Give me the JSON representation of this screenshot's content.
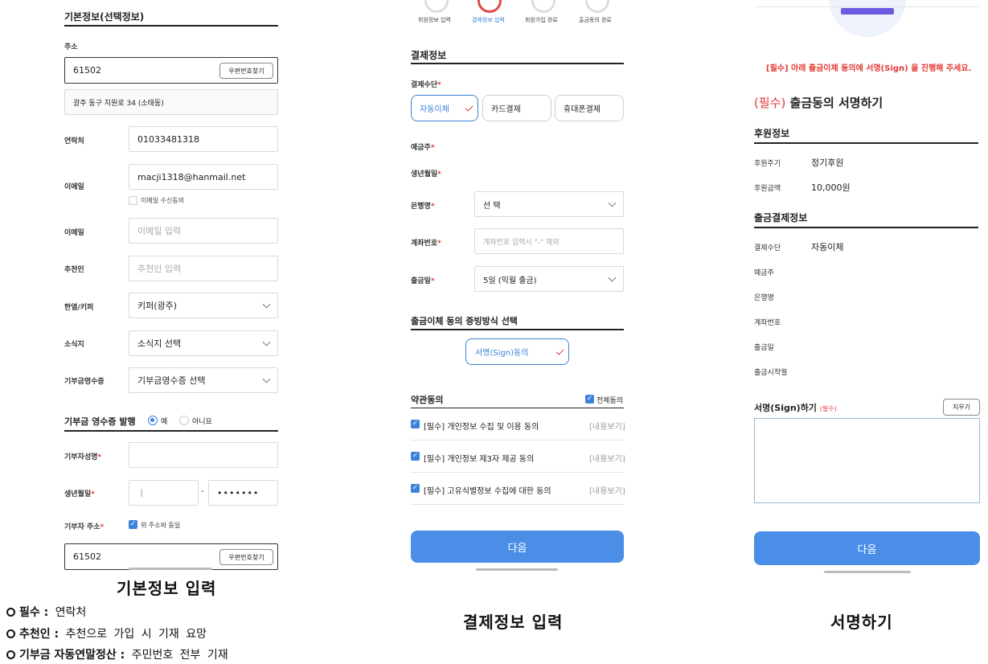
{
  "panel1": {
    "section_title": "기본정보(선택정보)",
    "address_label": "주소",
    "postcode": "61502",
    "postcode_btn": "우편번호찾기",
    "address_line": "광주 동구 지원로 34 (소태동)",
    "contact_label": "연락처",
    "contact_value": "01033481318",
    "email_label": "이메일",
    "email_value": "macji1318@hanmail.net",
    "email_consent": "이메일 수신동의",
    "email2_label": "이메일",
    "email2_placeholder": "이메일 입력",
    "referrer_label": "추천인",
    "referrer_placeholder": "추천인 입력",
    "hanyeol_label": "한열/키퍼",
    "hanyeol_value": "키퍼(광주)",
    "group_label": "소식지",
    "group_value": "소식지 선택",
    "receipt_label": "기부금영수증",
    "receipt_value": "기부금영수증 선택",
    "receipt_section": "기부금 영수증 발행",
    "radio_yes": "예",
    "radio_no": "아니요",
    "donor_name_label": "기부자성명",
    "birth_label": "생년월일",
    "birth_front": "ㅣ",
    "birth_dash": "-",
    "birth_back": "•••••••",
    "donor_addr_label": "기부자 주소",
    "same_addr": "위 주소와 동일",
    "postcode2": "61502",
    "postcode_btn2": "우편번호찾기",
    "caption": "기본정보 입력"
  },
  "notes": [
    {
      "bold": "필수 :",
      "text": "연락처"
    },
    {
      "bold": "추천인 :",
      "text": "추천으로 가입 시 기재 요망"
    },
    {
      "bold": "기부금 자동연말정산 :",
      "text": "주민번호 전부 기재"
    }
  ],
  "panel2": {
    "steps": [
      "회원정보 입력",
      "결제정보 입력",
      "회원가입 완료",
      "출금동의 완료"
    ],
    "section_title": "결제정보",
    "method_label": "결제수단",
    "methods": [
      "자동이체",
      "카드결제",
      "휴대폰결제"
    ],
    "depositor_label": "예금주",
    "birth_label": "생년월일",
    "bank_label": "은행명",
    "bank_value": "선 택",
    "account_label": "계좌번호",
    "account_placeholder": "계좌번호 입력시 \"-\" 제외",
    "withdraw_label": "출금일",
    "withdraw_value": "5일 (익월 출금)",
    "proof_title": "출금이체 동의 증빙방식 선택",
    "proof_option": "서명(Sign)동의",
    "terms_title": "약관동의",
    "all_agree": "전체동의",
    "terms": [
      "[필수] 개인정보 수집 및 이용 동의",
      "[필수] 개인정보 제3자 제공 동의",
      "[필수] 고유식별정보 수집에 대한 동의"
    ],
    "view_label": "[내용보기]",
    "next_btn": "다음",
    "caption": "결제정보 입력"
  },
  "panel3": {
    "notice": "[필수] 아래 출금이체 동의에 서명(Sign) 을 진행해 주세요.",
    "title_req": "(필수)",
    "title": "출금동의 서명하기",
    "support_title": "후원정보",
    "support_rows": [
      {
        "k": "후원주기",
        "v": "정기후원"
      },
      {
        "k": "후원금액",
        "v": "10,000원"
      }
    ],
    "pay_title": "출금결제정보",
    "pay_rows": [
      {
        "k": "결제수단",
        "v": "자동이체"
      },
      {
        "k": "예금주",
        "v": ""
      },
      {
        "k": "은행명",
        "v": ""
      },
      {
        "k": "계좌번호",
        "v": ""
      },
      {
        "k": "출금일",
        "v": ""
      },
      {
        "k": "출금시작월",
        "v": ""
      }
    ],
    "sign_title": "서명(Sign)하기",
    "sign_req": "(필수)",
    "clear_btn": "지우기",
    "next_btn": "다음",
    "caption": "서명하기"
  },
  "colors": {
    "accent": "#4a8ee8",
    "required": "#e53935"
  }
}
